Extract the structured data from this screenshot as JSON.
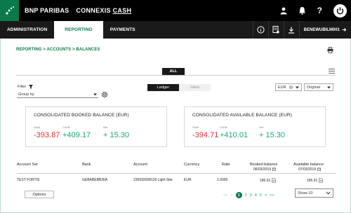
{
  "topbar": {
    "brand": "BNP PARIBAS",
    "product_prefix": "CONNEXIS",
    "product_suffix": "CASH",
    "icons": [
      "user-icon",
      "bell-icon",
      "help-icon",
      "power-icon"
    ],
    "help_glyph": "?"
  },
  "nav": {
    "items": [
      {
        "label": "ADMINISTRATION",
        "active": false
      },
      {
        "label": "REPORTING",
        "active": true
      },
      {
        "label": "PAYMENTS",
        "active": false
      }
    ],
    "user": "BENEWUBILM001",
    "info_glyph": "i"
  },
  "breadcrumb": "REPORTING > ACCOUNTS > BALANCES",
  "tabs": {
    "all_label": "ALL"
  },
  "filter": {
    "label": "Filter",
    "group_by": "Group by"
  },
  "view_toggle": {
    "ledger": "Ledger",
    "value": "Value"
  },
  "currency": {
    "selected": "EUR"
  },
  "mode": {
    "selected": "Original"
  },
  "cards": [
    {
      "title": "CONSOLIDATED BOOKED BALANCE (EUR)",
      "debit_label": "Debit",
      "credit_label": "Credit",
      "net_label": "Net",
      "debit": "-393.87",
      "credit": "+409.17",
      "net": "+ 15.30"
    },
    {
      "title": "CONSOLIDATED AVAILABLE BALANCE (EUR)",
      "debit_label": "Debit",
      "credit_label": "Credit",
      "net_label": "Net",
      "debit": "-394.71",
      "credit": "+410.01",
      "net": "+ 15.30"
    }
  ],
  "table": {
    "headers": {
      "account_set": "Account Set",
      "bank": "Bank",
      "account": "Account",
      "currency": "Currency",
      "rate": "Rate",
      "booked": "Booked balance",
      "booked_date": "06/03/2019",
      "available": "Available balance",
      "available_date": "07/03/2019"
    },
    "rows": [
      {
        "account_set": "TEST FORTIS",
        "bank": "GEBABEBB36A",
        "account": "230092008136 Light Site",
        "currency": "EUR",
        "rate": "1.0000",
        "booked": "185.91",
        "available": "185.91"
      }
    ]
  },
  "footer": {
    "options_label": "Options",
    "pages": [
      "1",
      "2",
      "3",
      "4",
      "5"
    ],
    "current_page": "1",
    "pager_first": "<<",
    "pager_prev": "<",
    "pager_next": ">",
    "pager_last": ">>",
    "show_selected": "Show 10"
  },
  "colors": {
    "brand_green": "#0a7a4b",
    "negative": "#e0303a",
    "positive": "#1aa874"
  }
}
